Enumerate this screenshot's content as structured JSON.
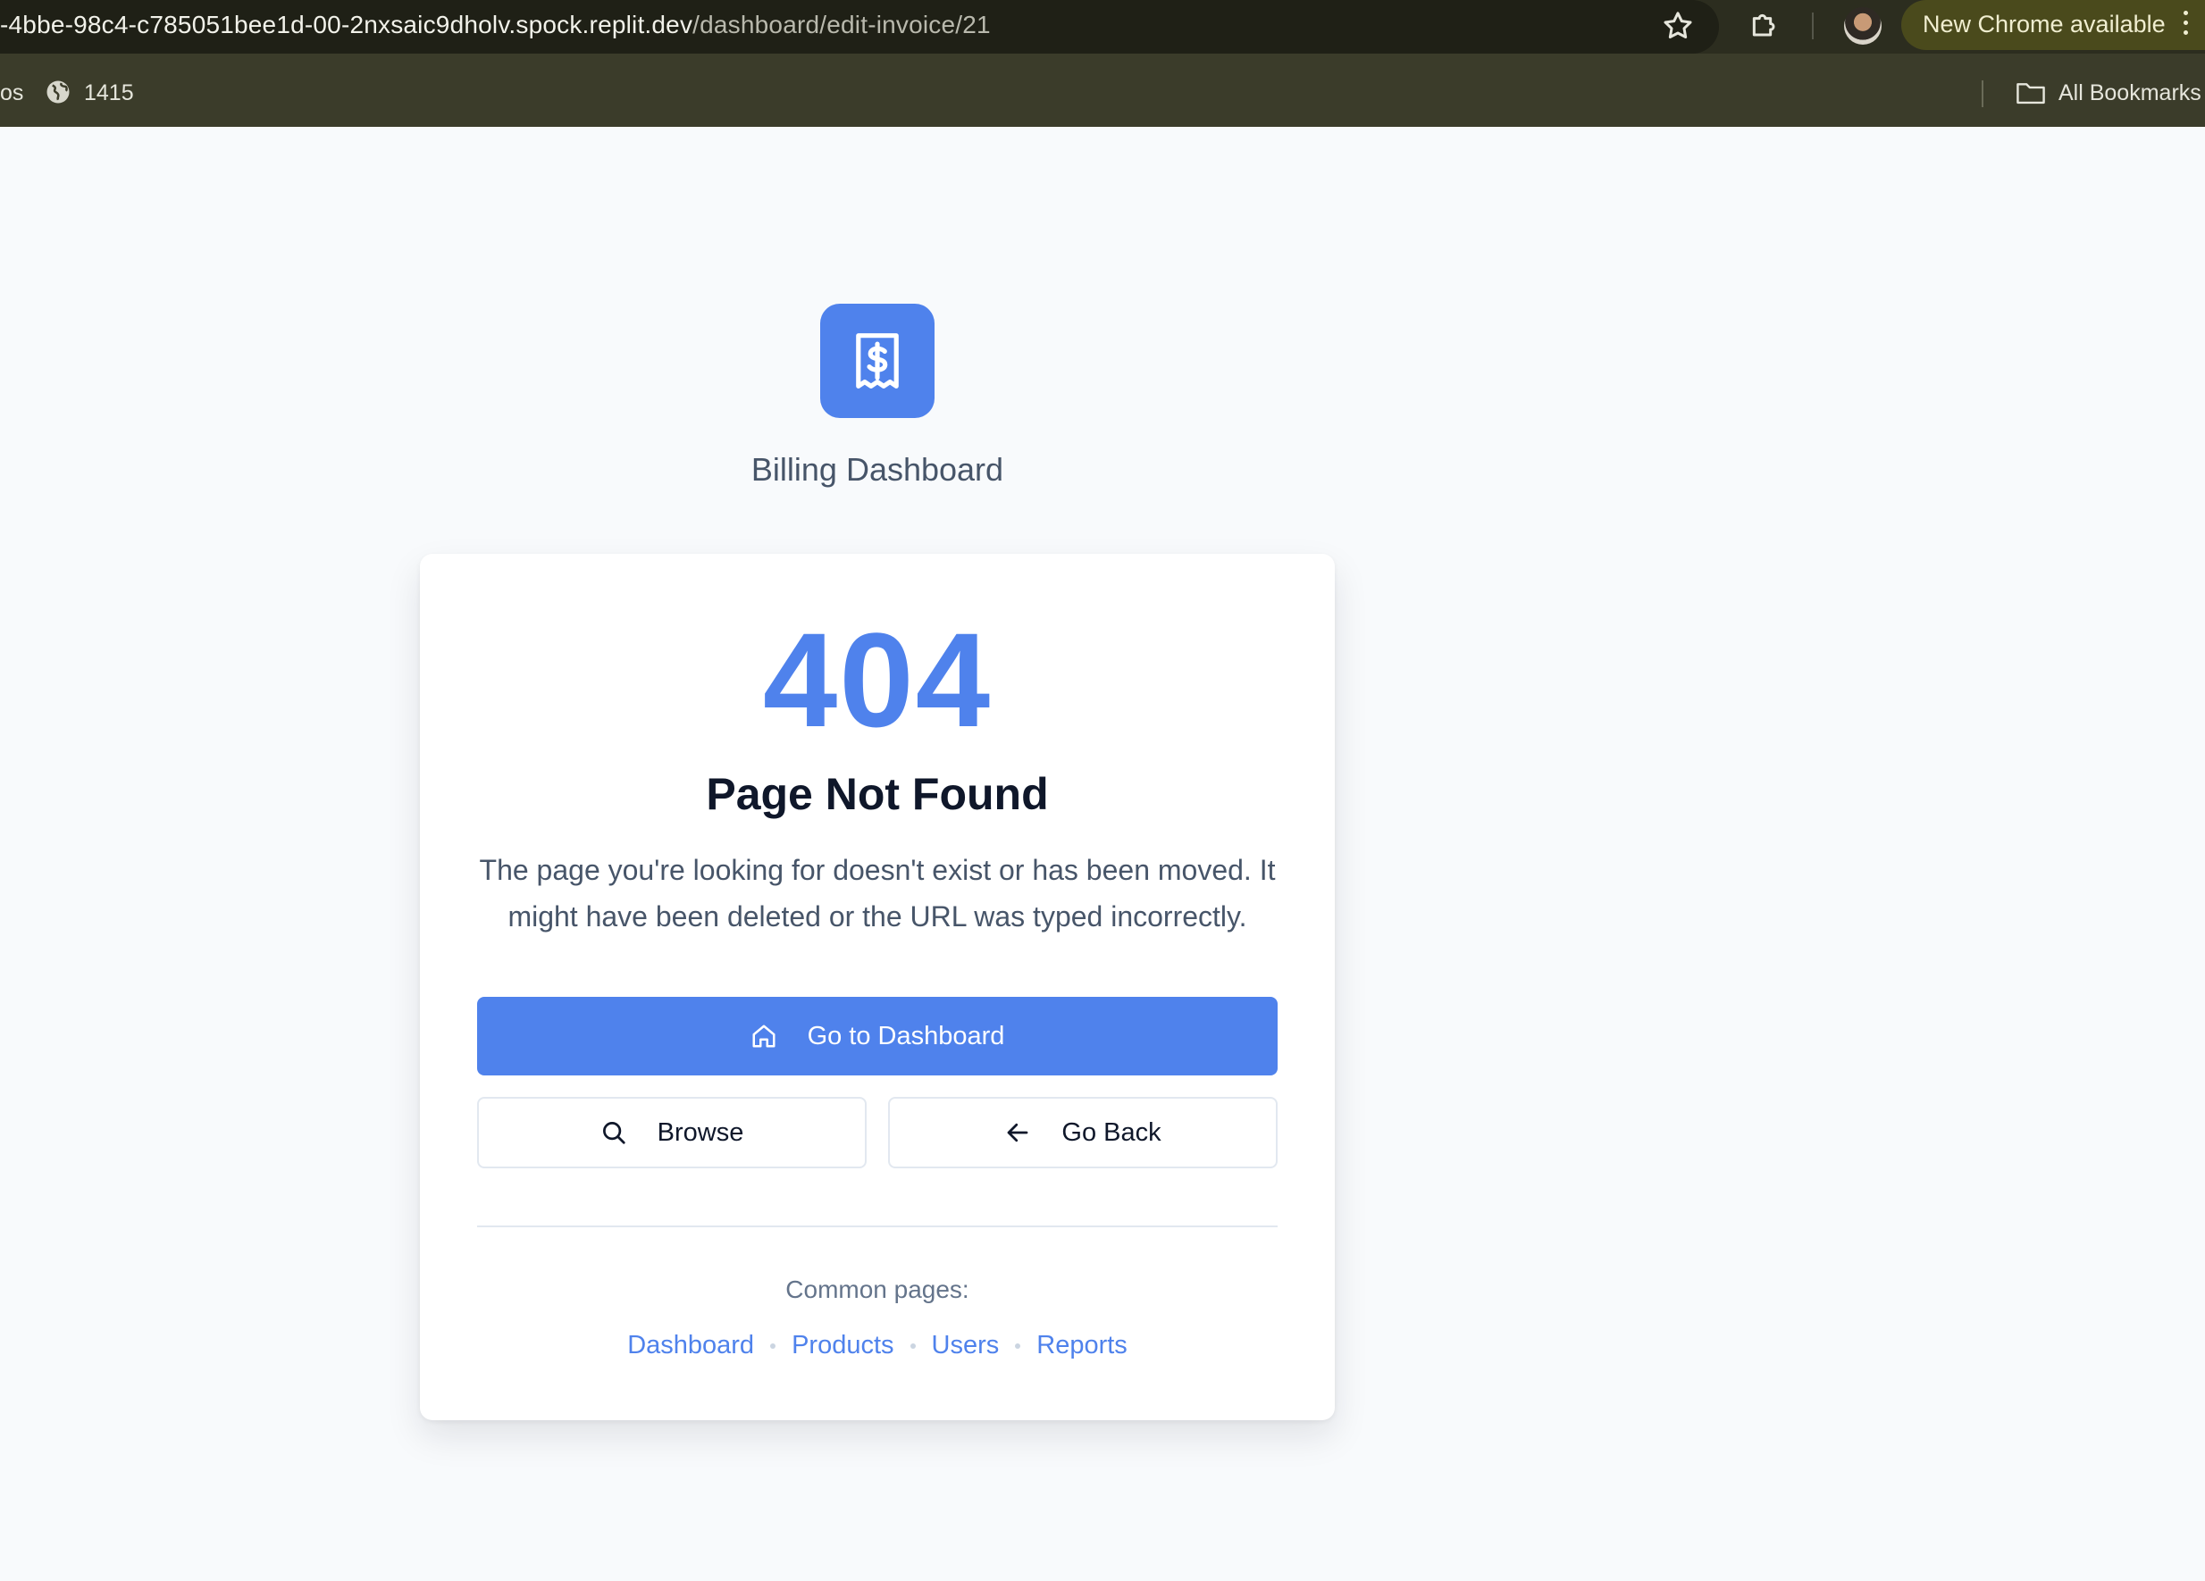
{
  "browser": {
    "url_host": "-4bbe-98c4-c785051bee1d-00-2nxsaic9dholv.spock.replit.dev",
    "url_path": "/dashboard/edit-invoice/21",
    "update_label": "New Chrome available",
    "bookmarks": {
      "partial_label": "os",
      "item_label": "1415",
      "all_label": "All Bookmarks"
    }
  },
  "app": {
    "name": "Billing Dashboard",
    "brand_color": "#4f82ec"
  },
  "error": {
    "code": "404",
    "title": "Page Not Found",
    "message": "The page you're looking for doesn't exist or has been moved. It might have been deleted or the URL was typed incorrectly."
  },
  "actions": {
    "primary_label": "Go to Dashboard",
    "browse_label": "Browse",
    "back_label": "Go Back"
  },
  "common": {
    "label": "Common pages:",
    "links": [
      "Dashboard",
      "Products",
      "Users",
      "Reports"
    ]
  },
  "icons": {
    "logo": "receipt-dollar-icon",
    "primary": "home-icon",
    "browse": "search-icon",
    "back": "arrow-left-icon"
  }
}
